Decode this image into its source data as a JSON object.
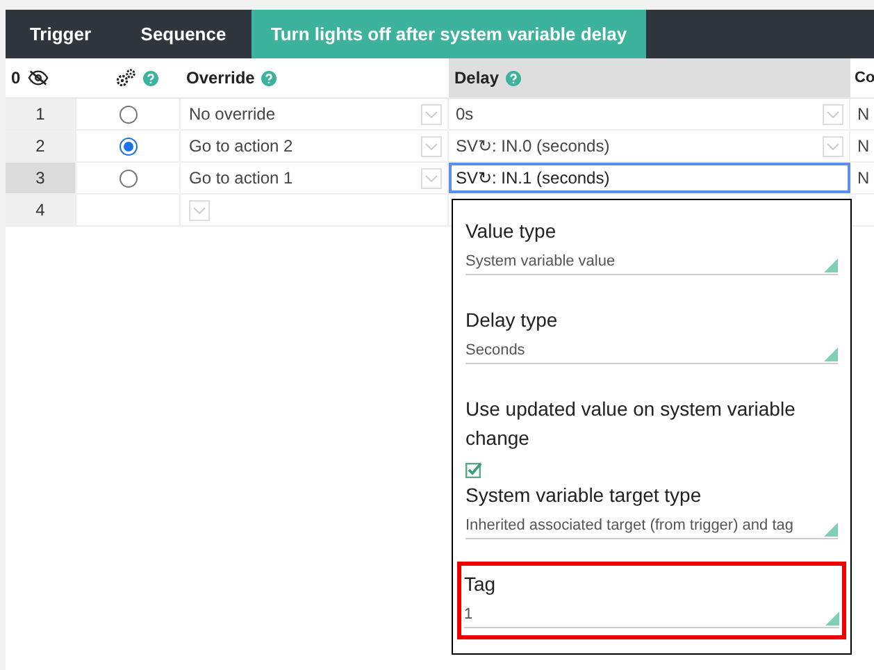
{
  "tabs": [
    {
      "label": "Trigger",
      "selected": false
    },
    {
      "label": "Sequence",
      "selected": false
    },
    {
      "label": "Turn lights off after system variable delay",
      "selected": true
    }
  ],
  "table": {
    "columns": [
      {
        "label": "0"
      },
      {
        "help": true
      },
      {
        "label": "Override",
        "help": true
      },
      {
        "label": "Delay",
        "help": true,
        "shaded": true
      },
      {
        "label": "Co"
      }
    ],
    "rows": [
      {
        "number": "1",
        "selected": false,
        "radio": false,
        "override": "No override",
        "delay": "0s",
        "column_5": "N"
      },
      {
        "number": "2",
        "selected": false,
        "radio": true,
        "override": "Go to action 2",
        "delay": "SV↻: IN.0 (seconds)",
        "column_5": "N"
      },
      {
        "number": "3",
        "selected": true,
        "radio": false,
        "override": "Go to action 1",
        "delay": "SV↻: IN.1 (seconds)",
        "focused": true,
        "column_5": "N"
      },
      {
        "number": "4",
        "selected": false
      }
    ]
  },
  "popover": {
    "fields": [
      {
        "kind": "select",
        "label": "Value type",
        "value": "System variable value"
      },
      {
        "kind": "select",
        "label": "Delay type",
        "value": "Seconds"
      },
      {
        "kind": "checkbox",
        "label": "Use updated value on system variable change",
        "checked": true
      },
      {
        "kind": "select",
        "label": "System variable target type",
        "value": "Inherited associated target (from trigger) and tag"
      },
      {
        "kind": "select",
        "label": "Tag",
        "value": "1",
        "highlighted": true
      }
    ]
  }
}
